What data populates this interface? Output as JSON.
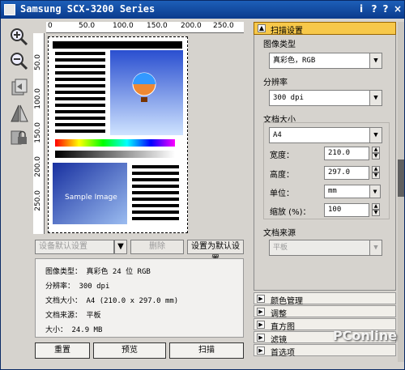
{
  "window": {
    "title": "Samsung SCX-3200 Series",
    "title_buttons": [
      "i",
      "?",
      "?",
      "×"
    ]
  },
  "left_tools": [
    {
      "icon": "zoom-in-icon"
    },
    {
      "icon": "zoom-out-icon"
    },
    {
      "icon": "rotate-icon"
    },
    {
      "icon": "flip-icon"
    },
    {
      "icon": "scan-lock-icon"
    }
  ],
  "ruler": {
    "top_ticks": [
      "0",
      "50.0",
      "100.0",
      "150.0",
      "200.0",
      "250.0"
    ],
    "left_ticks": [
      "50.0",
      "100.0",
      "150.0",
      "200.0",
      "250.0"
    ]
  },
  "preview": {
    "sample_text": "Sample Image"
  },
  "preset_bar": {
    "preset_select": "设备默认设置",
    "delete_button": "删除",
    "set_default_button": "设置为默认设置"
  },
  "info": {
    "rows": [
      {
        "label": "图像类型：",
        "value": "真彩色 24 位 RGB"
      },
      {
        "label": "分辨率：",
        "value": "300 dpi"
      },
      {
        "label": "文档大小：",
        "value": "A4 (210.0 x 297.0 mm)"
      },
      {
        "label": "文档来源：",
        "value": "平板"
      },
      {
        "label": "大小：",
        "value": "24.9 MB"
      }
    ]
  },
  "actions": {
    "reset": "重置",
    "preview": "预览",
    "scan": "扫描"
  },
  "panel": {
    "header": "扫描设置",
    "image_type_label": "图像类型",
    "image_type_value": "真彩色，RGB",
    "resolution_label": "分辨率",
    "resolution_value": "300 dpi",
    "doc_size_label": "文档大小",
    "doc_size_value": "A4",
    "width_label": "宽度：",
    "width_value": "210.0",
    "height_label": "高度：",
    "height_value": "297.0",
    "unit_label": "单位：",
    "unit_value": "mm",
    "scale_label": "缩放 (%)：",
    "scale_value": "100",
    "source_label": "文档来源",
    "source_value": "平板"
  },
  "sections": [
    "颜色管理",
    "调整",
    "直方图",
    "滤镜",
    "首选项"
  ],
  "watermark": "PConline"
}
